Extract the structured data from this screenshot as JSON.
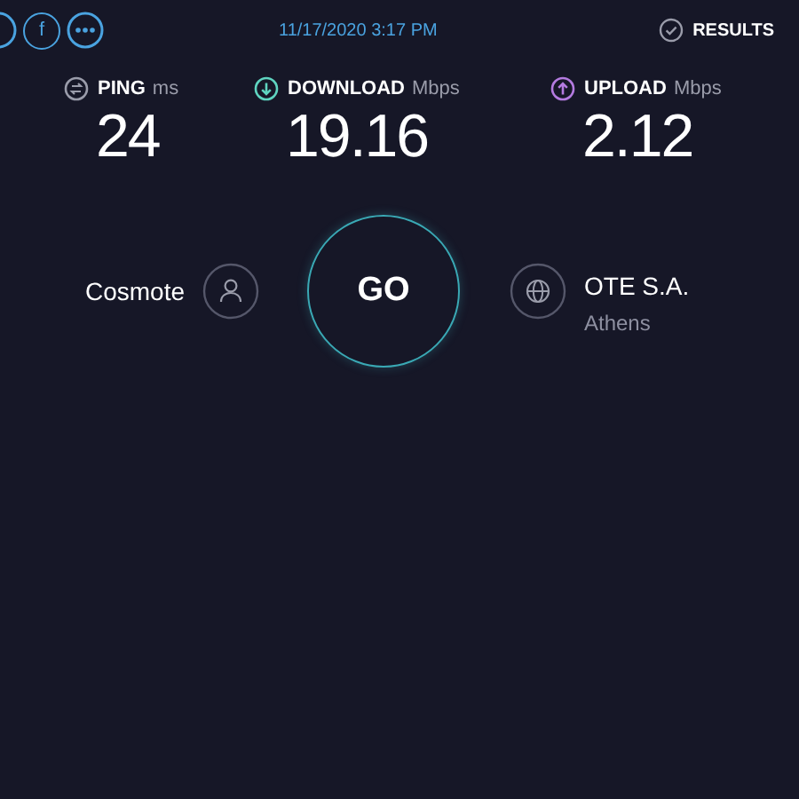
{
  "top_bar": {
    "facebook_glyph": "f",
    "date": "11/17/2020 3:17 PM",
    "results_label": "RESULTS"
  },
  "metrics": [
    {
      "kind": "ping",
      "label": "PING",
      "unit": "ms",
      "value": "24"
    },
    {
      "kind": "download",
      "label": "DOWNLOAD",
      "unit": "Mbps",
      "value": "19.16"
    },
    {
      "kind": "upload",
      "label": "UPLOAD",
      "unit": "Mbps",
      "value": "2.12"
    }
  ],
  "provider": {
    "name": "Cosmote"
  },
  "go_button": {
    "label": "GO"
  },
  "server": {
    "name": "OTE S.A.",
    "location": "Athens"
  }
}
